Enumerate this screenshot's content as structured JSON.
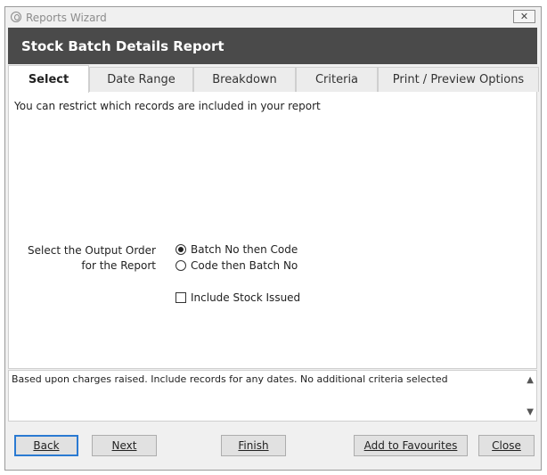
{
  "window": {
    "title": "Reports Wizard",
    "close_glyph": "✕"
  },
  "header": {
    "title": "Stock Batch Details Report"
  },
  "tabs": [
    {
      "label": "Select",
      "active": true
    },
    {
      "label": "Date Range",
      "active": false
    },
    {
      "label": "Breakdown",
      "active": false
    },
    {
      "label": "Criteria",
      "active": false
    },
    {
      "label": "Print / Preview Options",
      "active": false
    }
  ],
  "content": {
    "intro": "You can restrict which records are included in your report",
    "output_order": {
      "label_line1": "Select the Output Order",
      "label_line2": "for the Report",
      "options": [
        {
          "label": "Batch No then Code",
          "selected": true
        },
        {
          "label": "Code then Batch No",
          "selected": false
        }
      ]
    },
    "include_stock_issued": {
      "label": "Include Stock Issued",
      "checked": false
    }
  },
  "summary": {
    "text": "Based upon charges raised. Include records for any dates. No additional criteria selected"
  },
  "buttons": {
    "back": "Back",
    "next": "Next",
    "finish": "Finish",
    "add_to_favourites": "Add to Favourites",
    "close": "Close"
  },
  "colors": {
    "header_bg": "#4a4a4a",
    "default_button_border": "#2a7ad2"
  }
}
